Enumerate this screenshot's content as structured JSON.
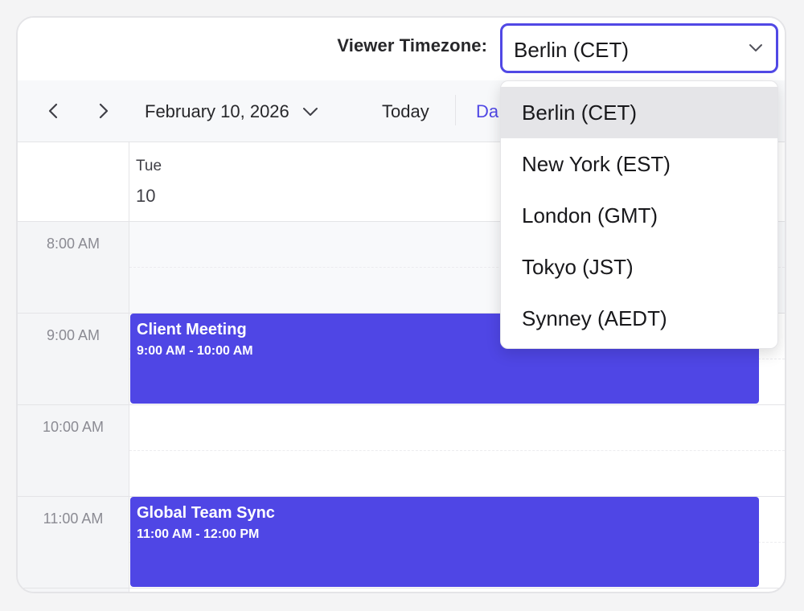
{
  "timezone": {
    "label": "Viewer Timezone:",
    "selected": "Berlin (CET)",
    "options": [
      "Berlin (CET)",
      "New York (EST)",
      "London (GMT)",
      "Tokyo (JST)",
      "Synney (AEDT)"
    ],
    "accent_color": "#5048e5"
  },
  "toolbar": {
    "prev_icon": "chevron-left-icon",
    "next_icon": "chevron-right-icon",
    "date": "February 10, 2026",
    "today_label": "Today",
    "view_label": "Da"
  },
  "day": {
    "name": "Tue",
    "number": "10"
  },
  "hours": [
    "8:00 AM",
    "9:00 AM",
    "10:00 AM",
    "11:00 AM"
  ],
  "events": [
    {
      "title": "Client Meeting",
      "time": "9:00 AM - 10:00 AM"
    },
    {
      "title": "Global Team Sync",
      "time": "11:00 AM - 12:00 PM"
    }
  ],
  "colors": {
    "event_bg": "#4f46e5",
    "gutter_bg": "#f4f5f7",
    "toolbar_bg": "#f7f8fa"
  }
}
